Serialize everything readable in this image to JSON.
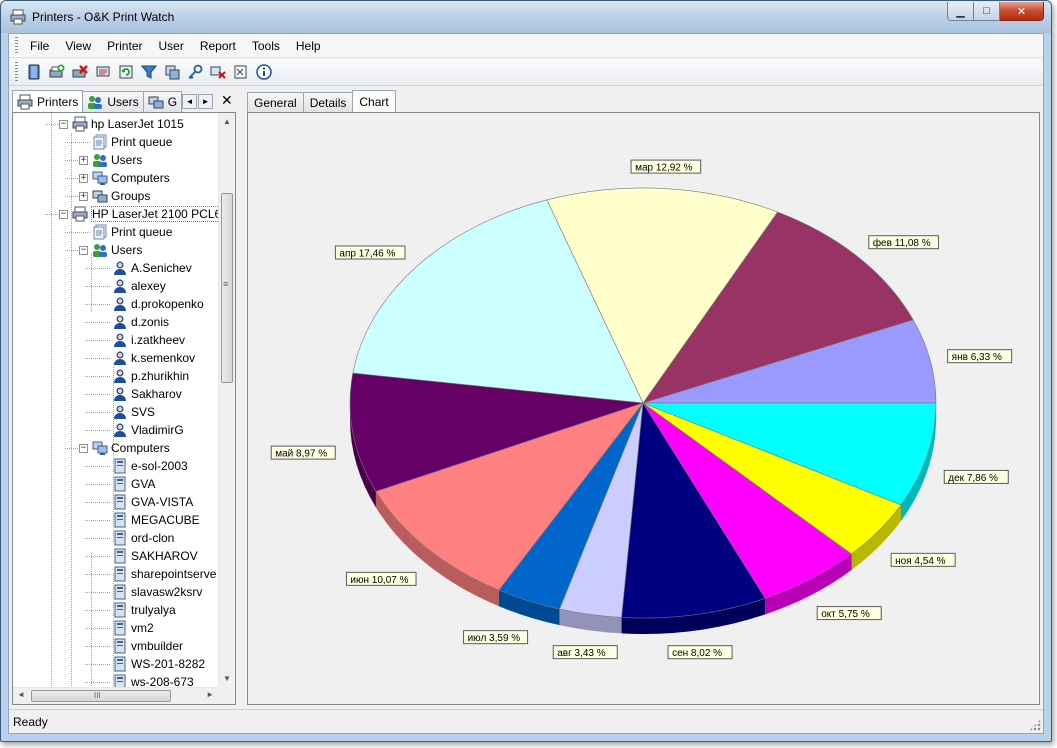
{
  "window": {
    "title": "Printers - O&K Print Watch",
    "icon": "printer-icon",
    "controls": {
      "minimize": "▁",
      "maximize": "□",
      "close": "✕"
    }
  },
  "menu": [
    "File",
    "View",
    "Printer",
    "User",
    "Report",
    "Tools",
    "Help"
  ],
  "toolbar": [
    "book-icon",
    "add-printer-icon",
    "delete-icon",
    "printers-list-icon",
    "refresh-icon",
    "filter-icon",
    "settings-icon",
    "key-icon",
    "remove-user-icon",
    "report-icon",
    "info-icon"
  ],
  "left_tabs": {
    "printers": "Printers",
    "users": "Users",
    "groups": "G",
    "prev": "◄",
    "next": "►",
    "close": "✕"
  },
  "tree": [
    {
      "label": "hp LaserJet 1015",
      "level": 1,
      "icon": "printer-icon",
      "expander": "−"
    },
    {
      "label": "Print queue",
      "level": 2,
      "icon": "print-queue-icon",
      "expander": ""
    },
    {
      "label": "Users",
      "level": 2,
      "icon": "users-icon",
      "expander": "+"
    },
    {
      "label": "Computers",
      "level": 2,
      "icon": "computers-icon",
      "expander": "+"
    },
    {
      "label": "Groups",
      "level": 2,
      "icon": "groups-icon",
      "expander": "+"
    },
    {
      "label": "HP LaserJet 2100 PCL6",
      "level": 1,
      "icon": "printer-icon",
      "expander": "−",
      "selected": true
    },
    {
      "label": "Print queue",
      "level": 2,
      "icon": "print-queue-icon",
      "expander": ""
    },
    {
      "label": "Users",
      "level": 2,
      "icon": "users-icon",
      "expander": "−"
    },
    {
      "label": "A.Senichev",
      "level": 3,
      "icon": "user-icon",
      "expander": ""
    },
    {
      "label": "alexey",
      "level": 3,
      "icon": "user-icon",
      "expander": ""
    },
    {
      "label": "d.prokopenko",
      "level": 3,
      "icon": "user-icon",
      "expander": ""
    },
    {
      "label": "d.zonis",
      "level": 3,
      "icon": "user-icon",
      "expander": ""
    },
    {
      "label": "i.zatkheev",
      "level": 3,
      "icon": "user-icon",
      "expander": ""
    },
    {
      "label": "k.semenkov",
      "level": 3,
      "icon": "user-icon",
      "expander": ""
    },
    {
      "label": "p.zhurikhin",
      "level": 3,
      "icon": "user-icon",
      "expander": ""
    },
    {
      "label": "Sakharov",
      "level": 3,
      "icon": "user-icon",
      "expander": ""
    },
    {
      "label": "SVS",
      "level": 3,
      "icon": "user-icon",
      "expander": ""
    },
    {
      "label": "VladimirG",
      "level": 3,
      "icon": "user-icon",
      "expander": ""
    },
    {
      "label": "Computers",
      "level": 2,
      "icon": "computers-icon",
      "expander": "−"
    },
    {
      "label": "e-sol-2003",
      "level": 3,
      "icon": "computer-icon",
      "expander": ""
    },
    {
      "label": "GVA",
      "level": 3,
      "icon": "computer-icon",
      "expander": ""
    },
    {
      "label": "GVA-VISTA",
      "level": 3,
      "icon": "computer-icon",
      "expander": ""
    },
    {
      "label": "MEGACUBE",
      "level": 3,
      "icon": "computer-icon",
      "expander": ""
    },
    {
      "label": "ord-clon",
      "level": 3,
      "icon": "computer-icon",
      "expander": ""
    },
    {
      "label": "SAKHAROV",
      "level": 3,
      "icon": "computer-icon",
      "expander": ""
    },
    {
      "label": "sharepointserve",
      "level": 3,
      "icon": "computer-icon",
      "expander": ""
    },
    {
      "label": "slavasw2ksrv",
      "level": 3,
      "icon": "computer-icon",
      "expander": ""
    },
    {
      "label": "trulyalya",
      "level": 3,
      "icon": "computer-icon",
      "expander": ""
    },
    {
      "label": "vm2",
      "level": 3,
      "icon": "computer-icon",
      "expander": ""
    },
    {
      "label": "vmbuilder",
      "level": 3,
      "icon": "computer-icon",
      "expander": ""
    },
    {
      "label": "WS-201-8282",
      "level": 3,
      "icon": "computer-icon",
      "expander": ""
    },
    {
      "label": "ws-208-673",
      "level": 3,
      "icon": "computer-icon",
      "expander": ""
    }
  ],
  "scroll": {
    "up": "▲",
    "down": "▼",
    "left": "◄",
    "right": "►",
    "grip_v": "≡",
    "grip_h": "III"
  },
  "right_tabs": [
    {
      "label": "General",
      "active": false
    },
    {
      "label": "Details",
      "active": false
    },
    {
      "label": "Chart",
      "active": true
    }
  ],
  "chart_data": {
    "type": "pie",
    "style": "3d",
    "slices": [
      {
        "name": "янв",
        "label": "янв 6,33 %",
        "value": 6.33,
        "color": "#9999ff"
      },
      {
        "name": "фев",
        "label": "фев 11,08 %",
        "value": 11.08,
        "color": "#993366"
      },
      {
        "name": "мар",
        "label": "мар 12,92 %",
        "value": 12.92,
        "color": "#ffffcc"
      },
      {
        "name": "апр",
        "label": "апр 17,46 %",
        "value": 17.46,
        "color": "#ccffff"
      },
      {
        "name": "май",
        "label": "май 8,97 %",
        "value": 8.97,
        "color": "#660066"
      },
      {
        "name": "июн",
        "label": "июн 10,07 %",
        "value": 10.07,
        "color": "#ff8080"
      },
      {
        "name": "июл",
        "label": "июл 3,59 %",
        "value": 3.59,
        "color": "#0066cc"
      },
      {
        "name": "авг",
        "label": "авг 3,43 %",
        "value": 3.43,
        "color": "#ccccff"
      },
      {
        "name": "сен",
        "label": "сен 8,02 %",
        "value": 8.02,
        "color": "#000080"
      },
      {
        "name": "окт",
        "label": "окт 5,75 %",
        "value": 5.75,
        "color": "#ff00ff"
      },
      {
        "name": "ноя",
        "label": "ноя 4,54 %",
        "value": 4.54,
        "color": "#ffff00"
      },
      {
        "name": "дек",
        "label": "дек 7,86 %",
        "value": 7.86,
        "color": "#00ffff"
      }
    ]
  },
  "status": "Ready"
}
